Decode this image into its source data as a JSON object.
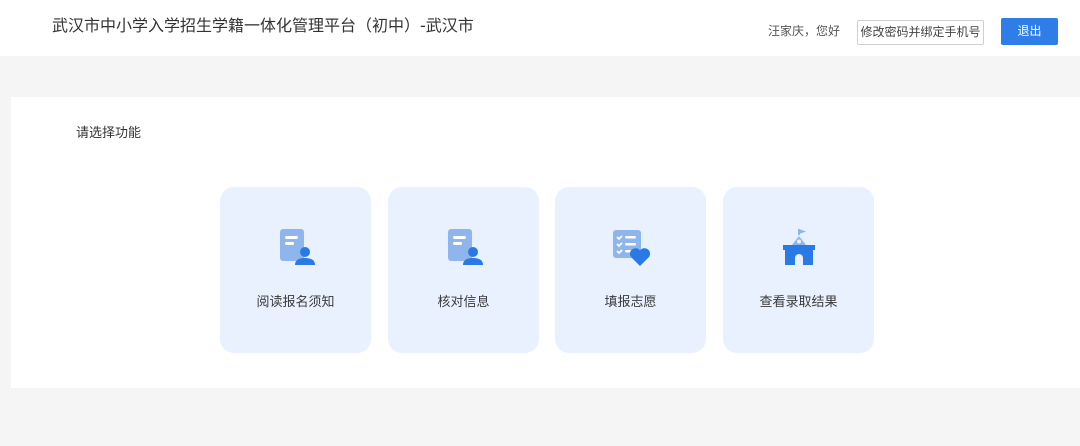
{
  "header": {
    "title": "武汉市中小学入学招生学籍一体化管理平台（初中）-武汉市",
    "greeting": "汪家庆，您好",
    "change_password_label": "修改密码并绑定手机号",
    "logout_label": "退出"
  },
  "main": {
    "section_title": "请选择功能",
    "functions": [
      {
        "label": "阅读报名须知",
        "icon": "document-user-icon"
      },
      {
        "label": "核对信息",
        "icon": "document-user-icon"
      },
      {
        "label": "填报志愿",
        "icon": "checklist-heart-icon"
      },
      {
        "label": "查看录取结果",
        "icon": "school-building-icon"
      }
    ]
  },
  "colors": {
    "accent": "#2f7ee8",
    "card_background": "#e8f1fd",
    "icon_light": "#8fb6ec",
    "icon_dark": "#2b79e4"
  }
}
